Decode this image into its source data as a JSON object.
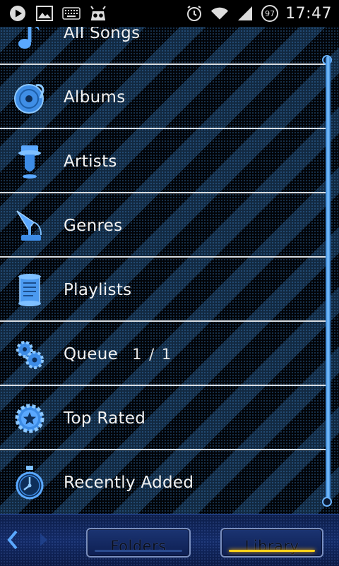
{
  "statusbar": {
    "time": "17:47",
    "battery_level": "97",
    "left_icons": [
      "play-icon",
      "image-icon",
      "keyboard-icon",
      "android-head-icon"
    ],
    "right_icons": [
      "alarm-icon",
      "wifi-icon",
      "signal-icon",
      "battery-icon"
    ]
  },
  "library": {
    "items": [
      {
        "label": "All Songs",
        "icon": "music-note-icon",
        "count": ""
      },
      {
        "label": "Albums",
        "icon": "vinyl-disc-icon",
        "count": ""
      },
      {
        "label": "Artists",
        "icon": "top-hat-icon",
        "count": ""
      },
      {
        "label": "Genres",
        "icon": "gramophone-icon",
        "count": ""
      },
      {
        "label": "Playlists",
        "icon": "scroll-icon",
        "count": ""
      },
      {
        "label": "Queue",
        "icon": "gears-icon",
        "count": "1 / 1"
      },
      {
        "label": "Top Rated",
        "icon": "star-badge-icon",
        "count": ""
      },
      {
        "label": "Recently Added",
        "icon": "stopwatch-icon",
        "count": ""
      }
    ]
  },
  "bottombar": {
    "folders_label": "Folders",
    "library_label": "Library",
    "active_tab": "library"
  },
  "colors": {
    "accent_blue": "#5aa8ff",
    "active_underline": "#ffd21a",
    "divider": "#d8dde2"
  }
}
